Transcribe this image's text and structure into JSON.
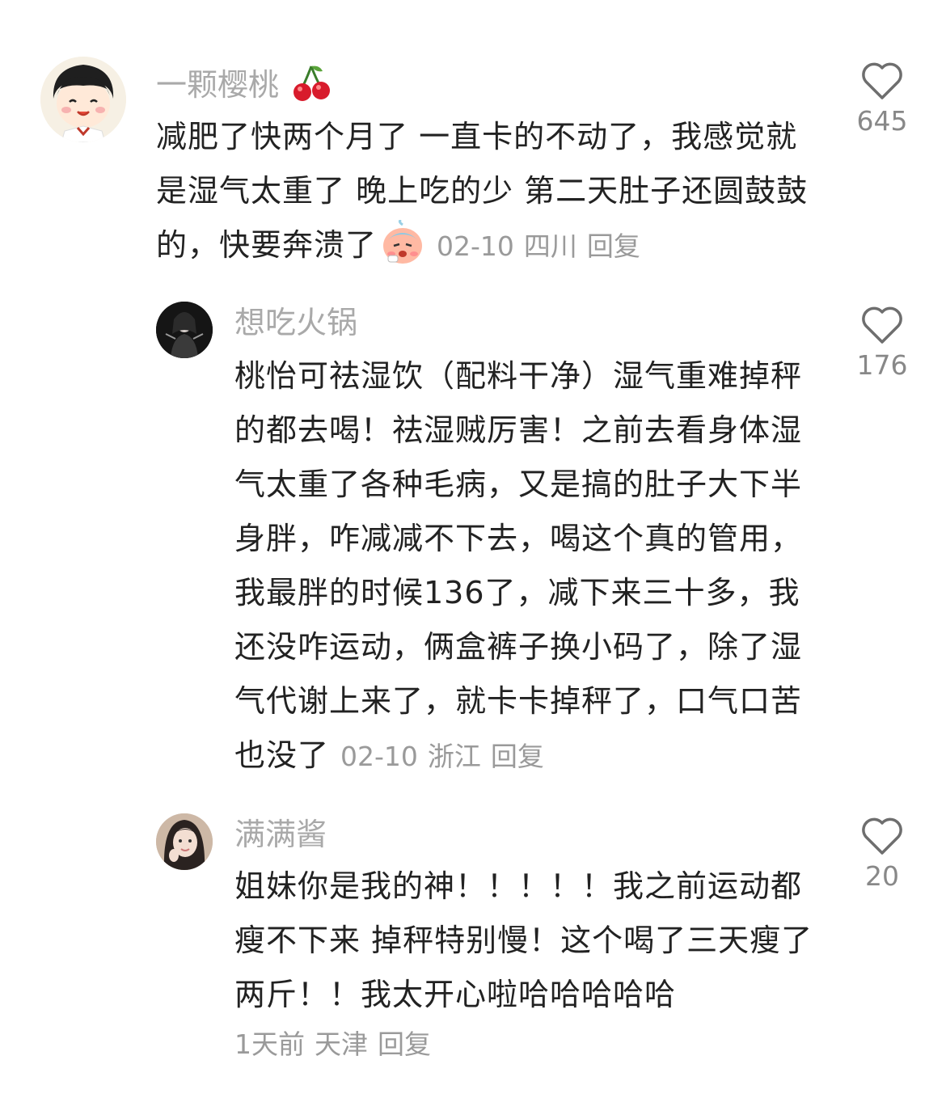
{
  "comments": [
    {
      "username": "一颗樱桃",
      "text": "减肥了快两个月了 一直卡的不动了，我感觉就是湿气太重了 晚上吃的少 第二天肚子还圆鼓鼓的，快要奔溃了",
      "date": "02-10",
      "location": "四川",
      "reply_label": "回复",
      "likes": "645",
      "avatar_icon": "cartoon-girl-avatar",
      "name_emoji": "cherry-icon",
      "text_emoji": "sad-face-icon"
    },
    {
      "username": "想吃火锅",
      "text": "桃怡可祛湿饮（配料干净）湿气重难掉秤的都去喝！祛湿贼厉害！之前去看身体湿气太重了各种毛病，又是搞的肚子大下半身胖，咋减减不下去，喝这个真的管用，我最胖的时候136了，减下来三十多，我还没咋运动，俩盒裤子换小码了，除了湿气代谢上来了，就卡卡掉秤了，口气口苦也没了",
      "date": "02-10",
      "location": "浙江",
      "reply_label": "回复",
      "likes": "176",
      "avatar_icon": "dark-photo-avatar"
    },
    {
      "username": "满满酱",
      "text": "姐妹你是我的神！！！！！我之前运动都瘦不下来 掉秤特别慢！这个喝了三天瘦了两斤！！我太开心啦哈哈哈哈哈",
      "date": "1天前",
      "location": "天津",
      "reply_label": "回复",
      "likes": "20",
      "avatar_icon": "girl-photo-avatar"
    }
  ]
}
